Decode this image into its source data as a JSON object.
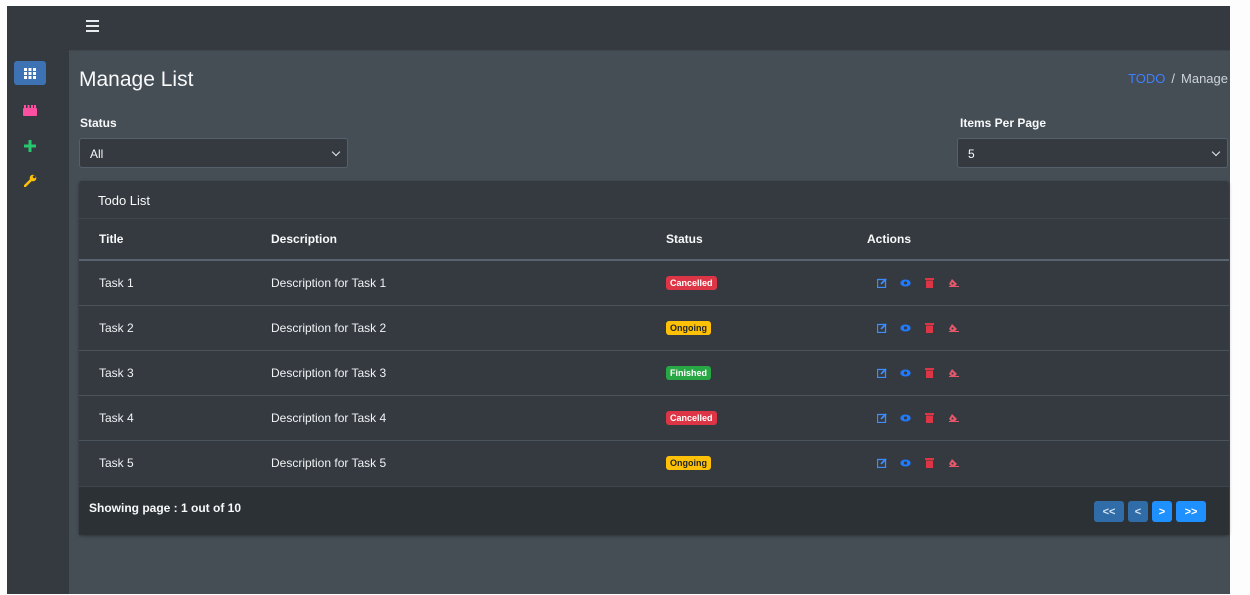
{
  "colors": {
    "accent": "#3f7fff",
    "cancelled": "#dc3545",
    "ongoing": "#ffc107",
    "finished": "#28a745",
    "edit": "#3c8dff",
    "view": "#1e7bff",
    "delete": "#dc3545",
    "erase": "#e8576a"
  },
  "sidebar": {
    "items": [
      {
        "icon": "grid-icon",
        "active": true
      },
      {
        "icon": "todo-list-icon",
        "active": false
      },
      {
        "icon": "plus-icon",
        "active": false
      },
      {
        "icon": "wrench-icon",
        "active": false
      }
    ]
  },
  "topbar": {
    "menu_icon": "hamburger-icon"
  },
  "page": {
    "title": "Manage List"
  },
  "breadcrumb": {
    "link": "TODO",
    "separator": "/",
    "current": "Manage"
  },
  "filters": {
    "status_label": "Status",
    "status_value": "All",
    "per_page_label": "Items Per Page",
    "per_page_value": "5"
  },
  "card": {
    "title": "Todo List"
  },
  "table": {
    "headers": [
      "Title",
      "Description",
      "Status",
      "Actions"
    ],
    "rows": [
      {
        "title": "Task 1",
        "description": "Description for Task 1",
        "status": "Cancelled",
        "status_color": "#dc3545"
      },
      {
        "title": "Task 2",
        "description": "Description for Task 2",
        "status": "Ongoing",
        "status_color": "#ffc107"
      },
      {
        "title": "Task 3",
        "description": "Description for Task 3",
        "status": "Finished",
        "status_color": "#28a745"
      },
      {
        "title": "Task 4",
        "description": "Description for Task 4",
        "status": "Cancelled",
        "status_color": "#dc3545"
      },
      {
        "title": "Task 5",
        "description": "Description for Task 5",
        "status": "Ongoing",
        "status_color": "#ffc107"
      }
    ],
    "action_icons": [
      "edit-icon",
      "view-icon",
      "delete-icon",
      "erase-icon"
    ]
  },
  "footer": {
    "text": "Showing page : 1 out of 10",
    "pager": {
      "first": "<<",
      "prev": "<",
      "next": ">",
      "last": ">>"
    }
  }
}
